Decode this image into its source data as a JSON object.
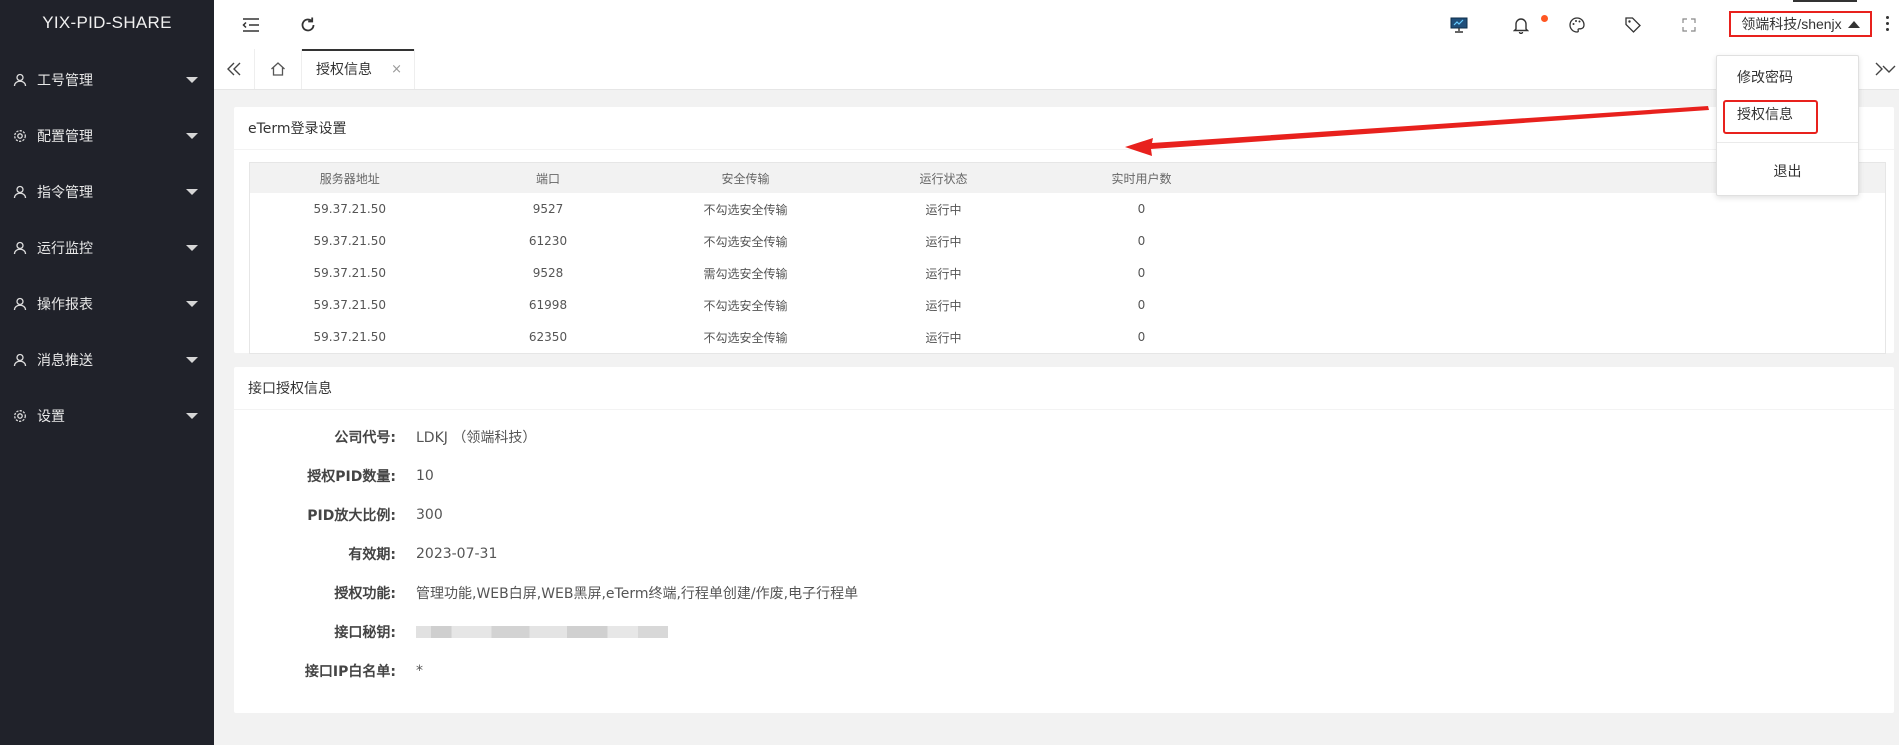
{
  "app": {
    "title": "YIX-PID-SHARE"
  },
  "sidebar": {
    "items": [
      {
        "label": "工号管理",
        "icon": "user-icon"
      },
      {
        "label": "配置管理",
        "icon": "gear-icon"
      },
      {
        "label": "指令管理",
        "icon": "user-icon"
      },
      {
        "label": "运行监控",
        "icon": "user-icon"
      },
      {
        "label": "操作报表",
        "icon": "user-icon"
      },
      {
        "label": "消息推送",
        "icon": "user-icon"
      },
      {
        "label": "设置",
        "icon": "gear-icon"
      }
    ]
  },
  "header": {
    "user": "领端科技/shenjx",
    "icons": [
      "menu-collapse-icon",
      "refresh-icon",
      "monitor-icon",
      "bell-icon",
      "palette-icon",
      "tag-icon",
      "fullscreen-icon",
      "more-icon"
    ]
  },
  "tabs": {
    "active": {
      "label": "授权信息",
      "close": "×"
    }
  },
  "dropdown": {
    "items": [
      "修改密码",
      "授权信息",
      "退出"
    ]
  },
  "eterm": {
    "title": "eTerm登录设置",
    "columns": [
      "服务器地址",
      "端口",
      "安全传输",
      "运行状态",
      "实时用户数"
    ],
    "rows": [
      [
        "59.37.21.50",
        "9527",
        "不勾选安全传输",
        "运行中",
        "0"
      ],
      [
        "59.37.21.50",
        "61230",
        "不勾选安全传输",
        "运行中",
        "0"
      ],
      [
        "59.37.21.50",
        "9528",
        "需勾选安全传输",
        "运行中",
        "0"
      ],
      [
        "59.37.21.50",
        "61998",
        "不勾选安全传输",
        "运行中",
        "0"
      ],
      [
        "59.37.21.50",
        "62350",
        "不勾选安全传输",
        "运行中",
        "0"
      ]
    ]
  },
  "auth": {
    "title": "接口授权信息",
    "fields": [
      {
        "label": "公司代号:",
        "value": "LDKJ （领端科技）"
      },
      {
        "label": "授权PID数量:",
        "value": "10"
      },
      {
        "label": "PID放大比例:",
        "value": "300"
      },
      {
        "label": "有效期:",
        "value": "2023-07-31"
      },
      {
        "label": "授权功能:",
        "value": "管理功能,WEB白屏,WEB黑屏,eTerm终端,行程单创建/作废,电子行程单"
      },
      {
        "label": "接口秘钥:",
        "value": ""
      },
      {
        "label": "接口IP白名单:",
        "value": "*"
      }
    ]
  },
  "colors": {
    "sidebar_bg": "#20222a",
    "highlight": "#e8211d",
    "badge": "#ff5722"
  }
}
